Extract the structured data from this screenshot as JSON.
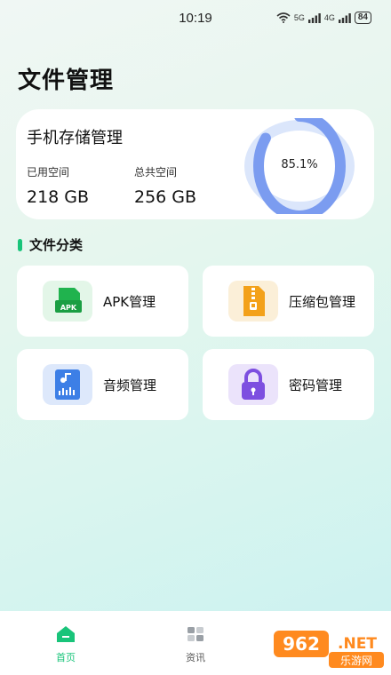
{
  "status_bar": {
    "time": "10:19",
    "net1": "5G",
    "net2": "4G",
    "battery": "84"
  },
  "page": {
    "title": "文件管理"
  },
  "storage": {
    "title": "手机存储管理",
    "used_label": "已用空间",
    "used_value": "218 GB",
    "total_label": "总共空间",
    "total_value": "256 GB",
    "percent_text": "85.1%",
    "percent": 0.851,
    "ring_color": "#7b9cf0",
    "ring_track": "#dbe6fb"
  },
  "section": {
    "title": "文件分类",
    "accent": "#19c47a"
  },
  "categories": [
    {
      "label": "APK管理",
      "icon": "apk-icon",
      "icon_text": "APK",
      "bg": "#e3f6e8",
      "fg": "#20b34e"
    },
    {
      "label": "压缩包管理",
      "icon": "zip-icon",
      "bg": "#fbefd8",
      "fg": "#f3a11a"
    },
    {
      "label": "音频管理",
      "icon": "audio-icon",
      "bg": "#dde8fb",
      "fg": "#3d7fe6"
    },
    {
      "label": "密码管理",
      "icon": "lock-icon",
      "bg": "#ebe3fb",
      "fg": "#7d4fe0"
    }
  ],
  "tabbar": {
    "home_label": "首页",
    "news_label": "资讯",
    "active_color": "#19c47a"
  },
  "watermark": {
    "brand": "962.NET",
    "sub": "乐游网"
  }
}
